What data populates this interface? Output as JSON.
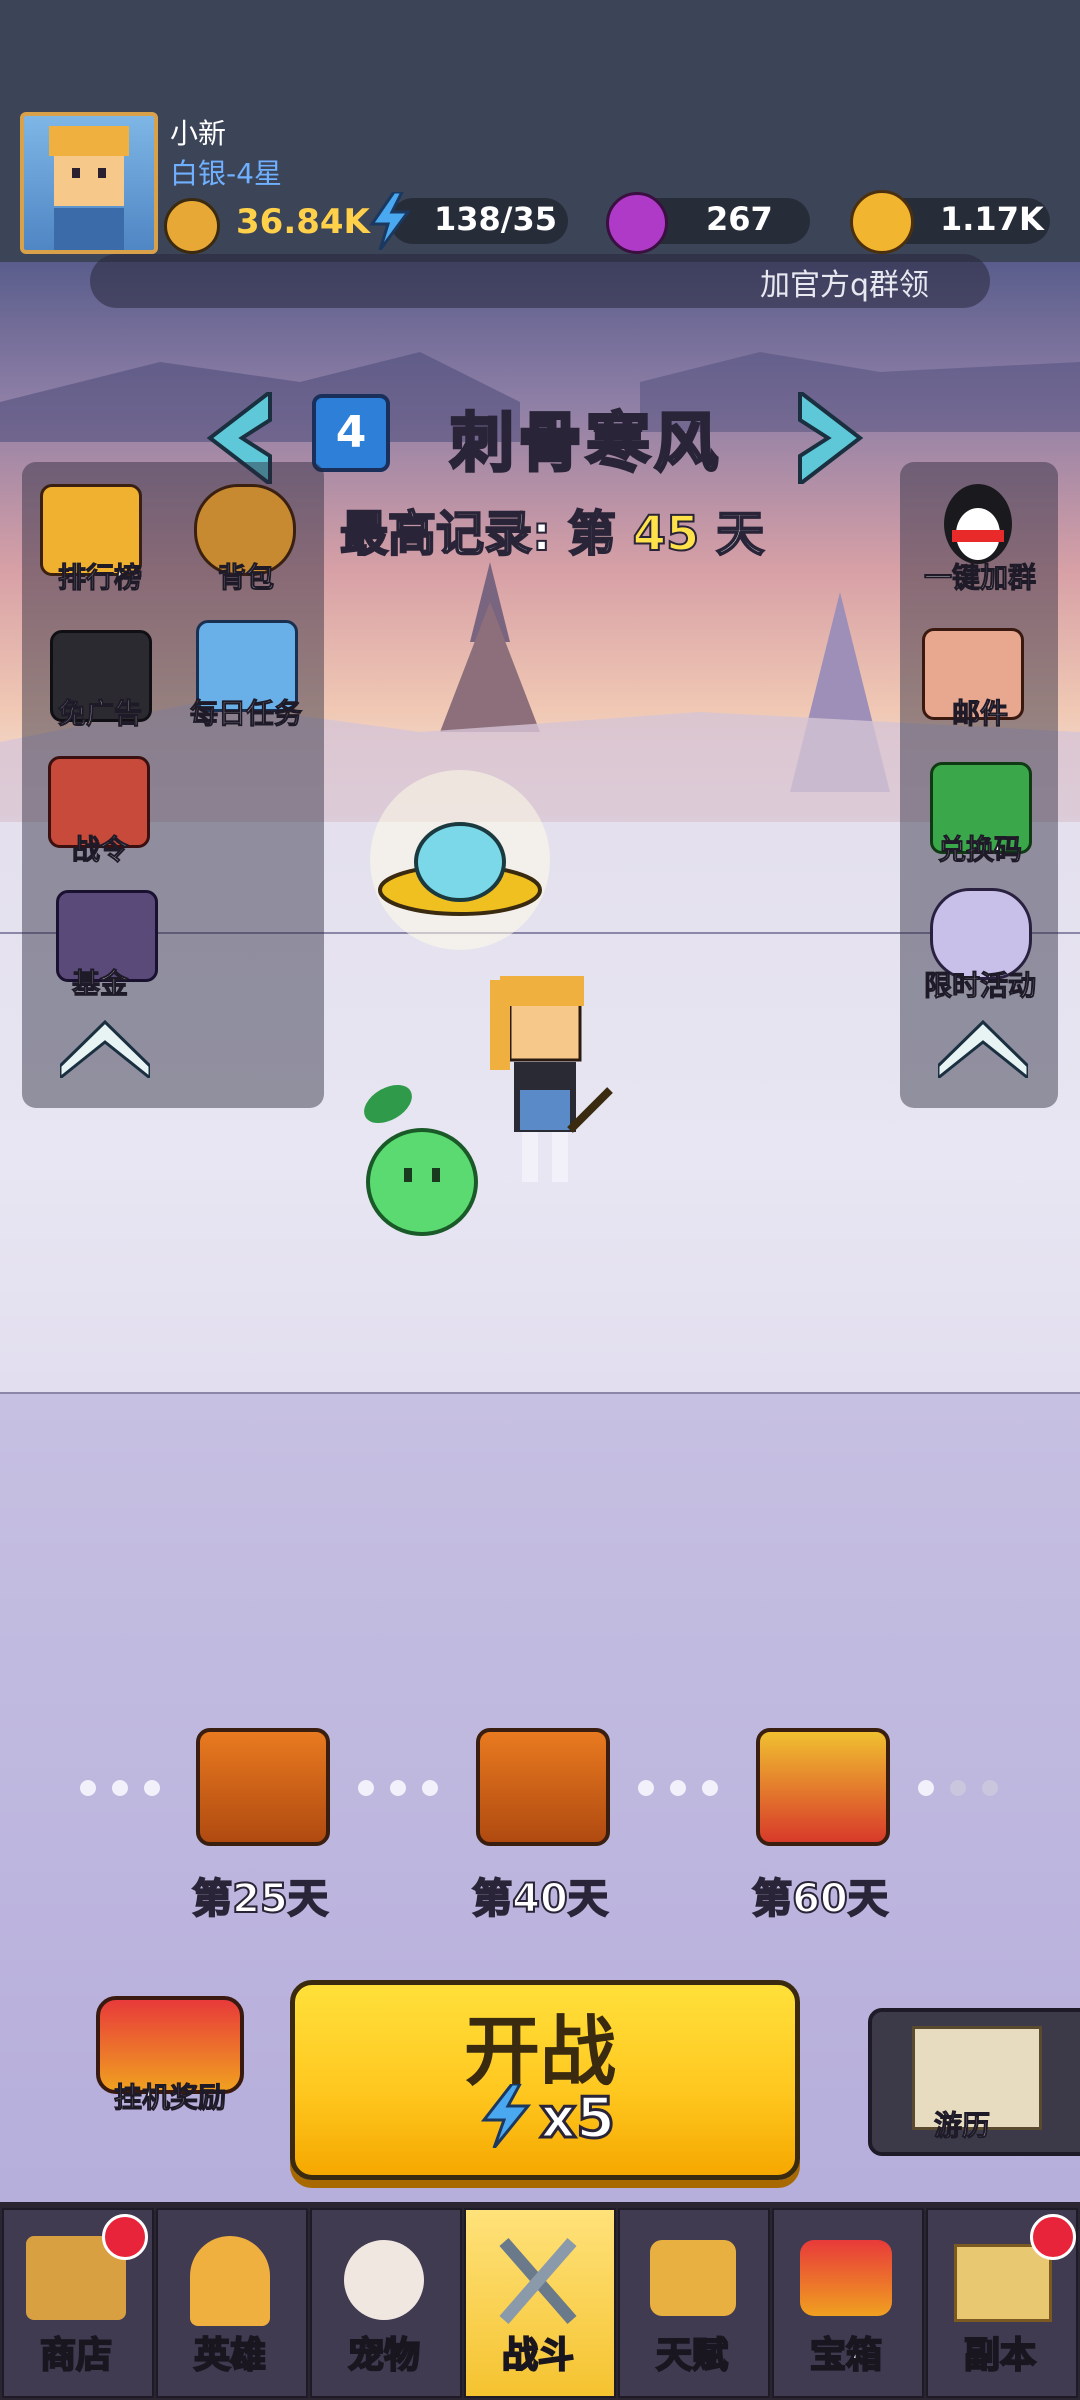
{
  "player": {
    "name": "小新",
    "rank": "白银-4星"
  },
  "resources": {
    "power": "36.84K",
    "energy": "138/35",
    "gems": "267",
    "coins": "1.17K"
  },
  "group_banner": "加官方q群领",
  "stage": {
    "number": "4",
    "title": "刺骨寒风",
    "best_record_prefix": "最高记录: 第",
    "best_record_day": "45",
    "best_record_suffix": "天"
  },
  "left_menu": [
    {
      "label": "排行榜",
      "icon": "leaderboard-icon"
    },
    {
      "label": "背包",
      "icon": "backpack-icon"
    },
    {
      "label": "免广告",
      "icon": "no-ads-icon"
    },
    {
      "label": "每日任务",
      "icon": "daily-task-icon"
    },
    {
      "label": "战令",
      "icon": "battle-pass-icon"
    },
    {
      "label": "基金",
      "icon": "fund-icon"
    }
  ],
  "right_menu": [
    {
      "label": "一键加群",
      "icon": "qq-penguin-icon"
    },
    {
      "label": "邮件",
      "icon": "mail-icon"
    },
    {
      "label": "兑换码",
      "icon": "redeem-code-icon"
    },
    {
      "label": "限时活动",
      "icon": "limited-event-icon"
    }
  ],
  "milestones": [
    {
      "label": "第25天"
    },
    {
      "label": "第40天"
    },
    {
      "label": "第60天"
    }
  ],
  "idle_reward": "挂机奖励",
  "battle": {
    "label": "开战",
    "cost": "x5"
  },
  "travel": "游历",
  "nav": [
    {
      "label": "商店",
      "badge": true
    },
    {
      "label": "英雄",
      "badge": false
    },
    {
      "label": "宠物",
      "badge": false
    },
    {
      "label": "战斗",
      "badge": false,
      "active": true
    },
    {
      "label": "天赋",
      "badge": false
    },
    {
      "label": "宝箱",
      "badge": false
    },
    {
      "label": "副本",
      "badge": true
    }
  ],
  "colors": {
    "accent_yellow": "#ffd04a",
    "badge_red": "#e8243a",
    "rank_blue": "#6fb0ff"
  }
}
